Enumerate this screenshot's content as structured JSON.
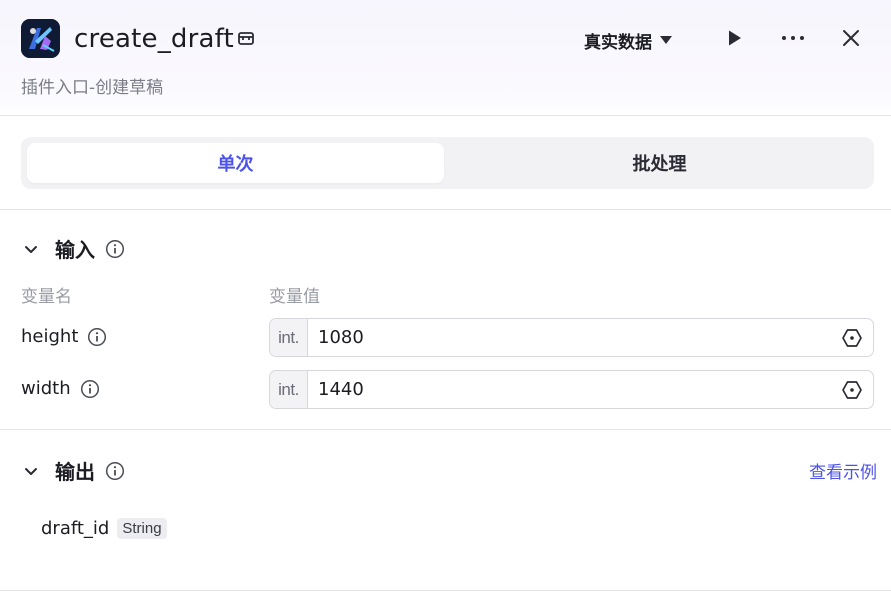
{
  "header": {
    "title": "create_draft",
    "description": "插件入口-创建草稿",
    "data_select": "真实数据"
  },
  "tabs": [
    {
      "label": "单次",
      "active": true
    },
    {
      "label": "批处理",
      "active": false
    }
  ],
  "input": {
    "title": "输入",
    "col_name": "变量名",
    "col_value": "变量值",
    "rows": [
      {
        "name": "height",
        "type": "int.",
        "value": "1080"
      },
      {
        "name": "width",
        "type": "int.",
        "value": "1440"
      }
    ]
  },
  "output": {
    "title": "输出",
    "view_example": "查看示例",
    "fields": [
      {
        "name": "draft_id",
        "type": "String"
      }
    ]
  },
  "colors": {
    "accent": "#4d53e8",
    "text": "#1c1d23",
    "muted": "#9a9ca5"
  }
}
